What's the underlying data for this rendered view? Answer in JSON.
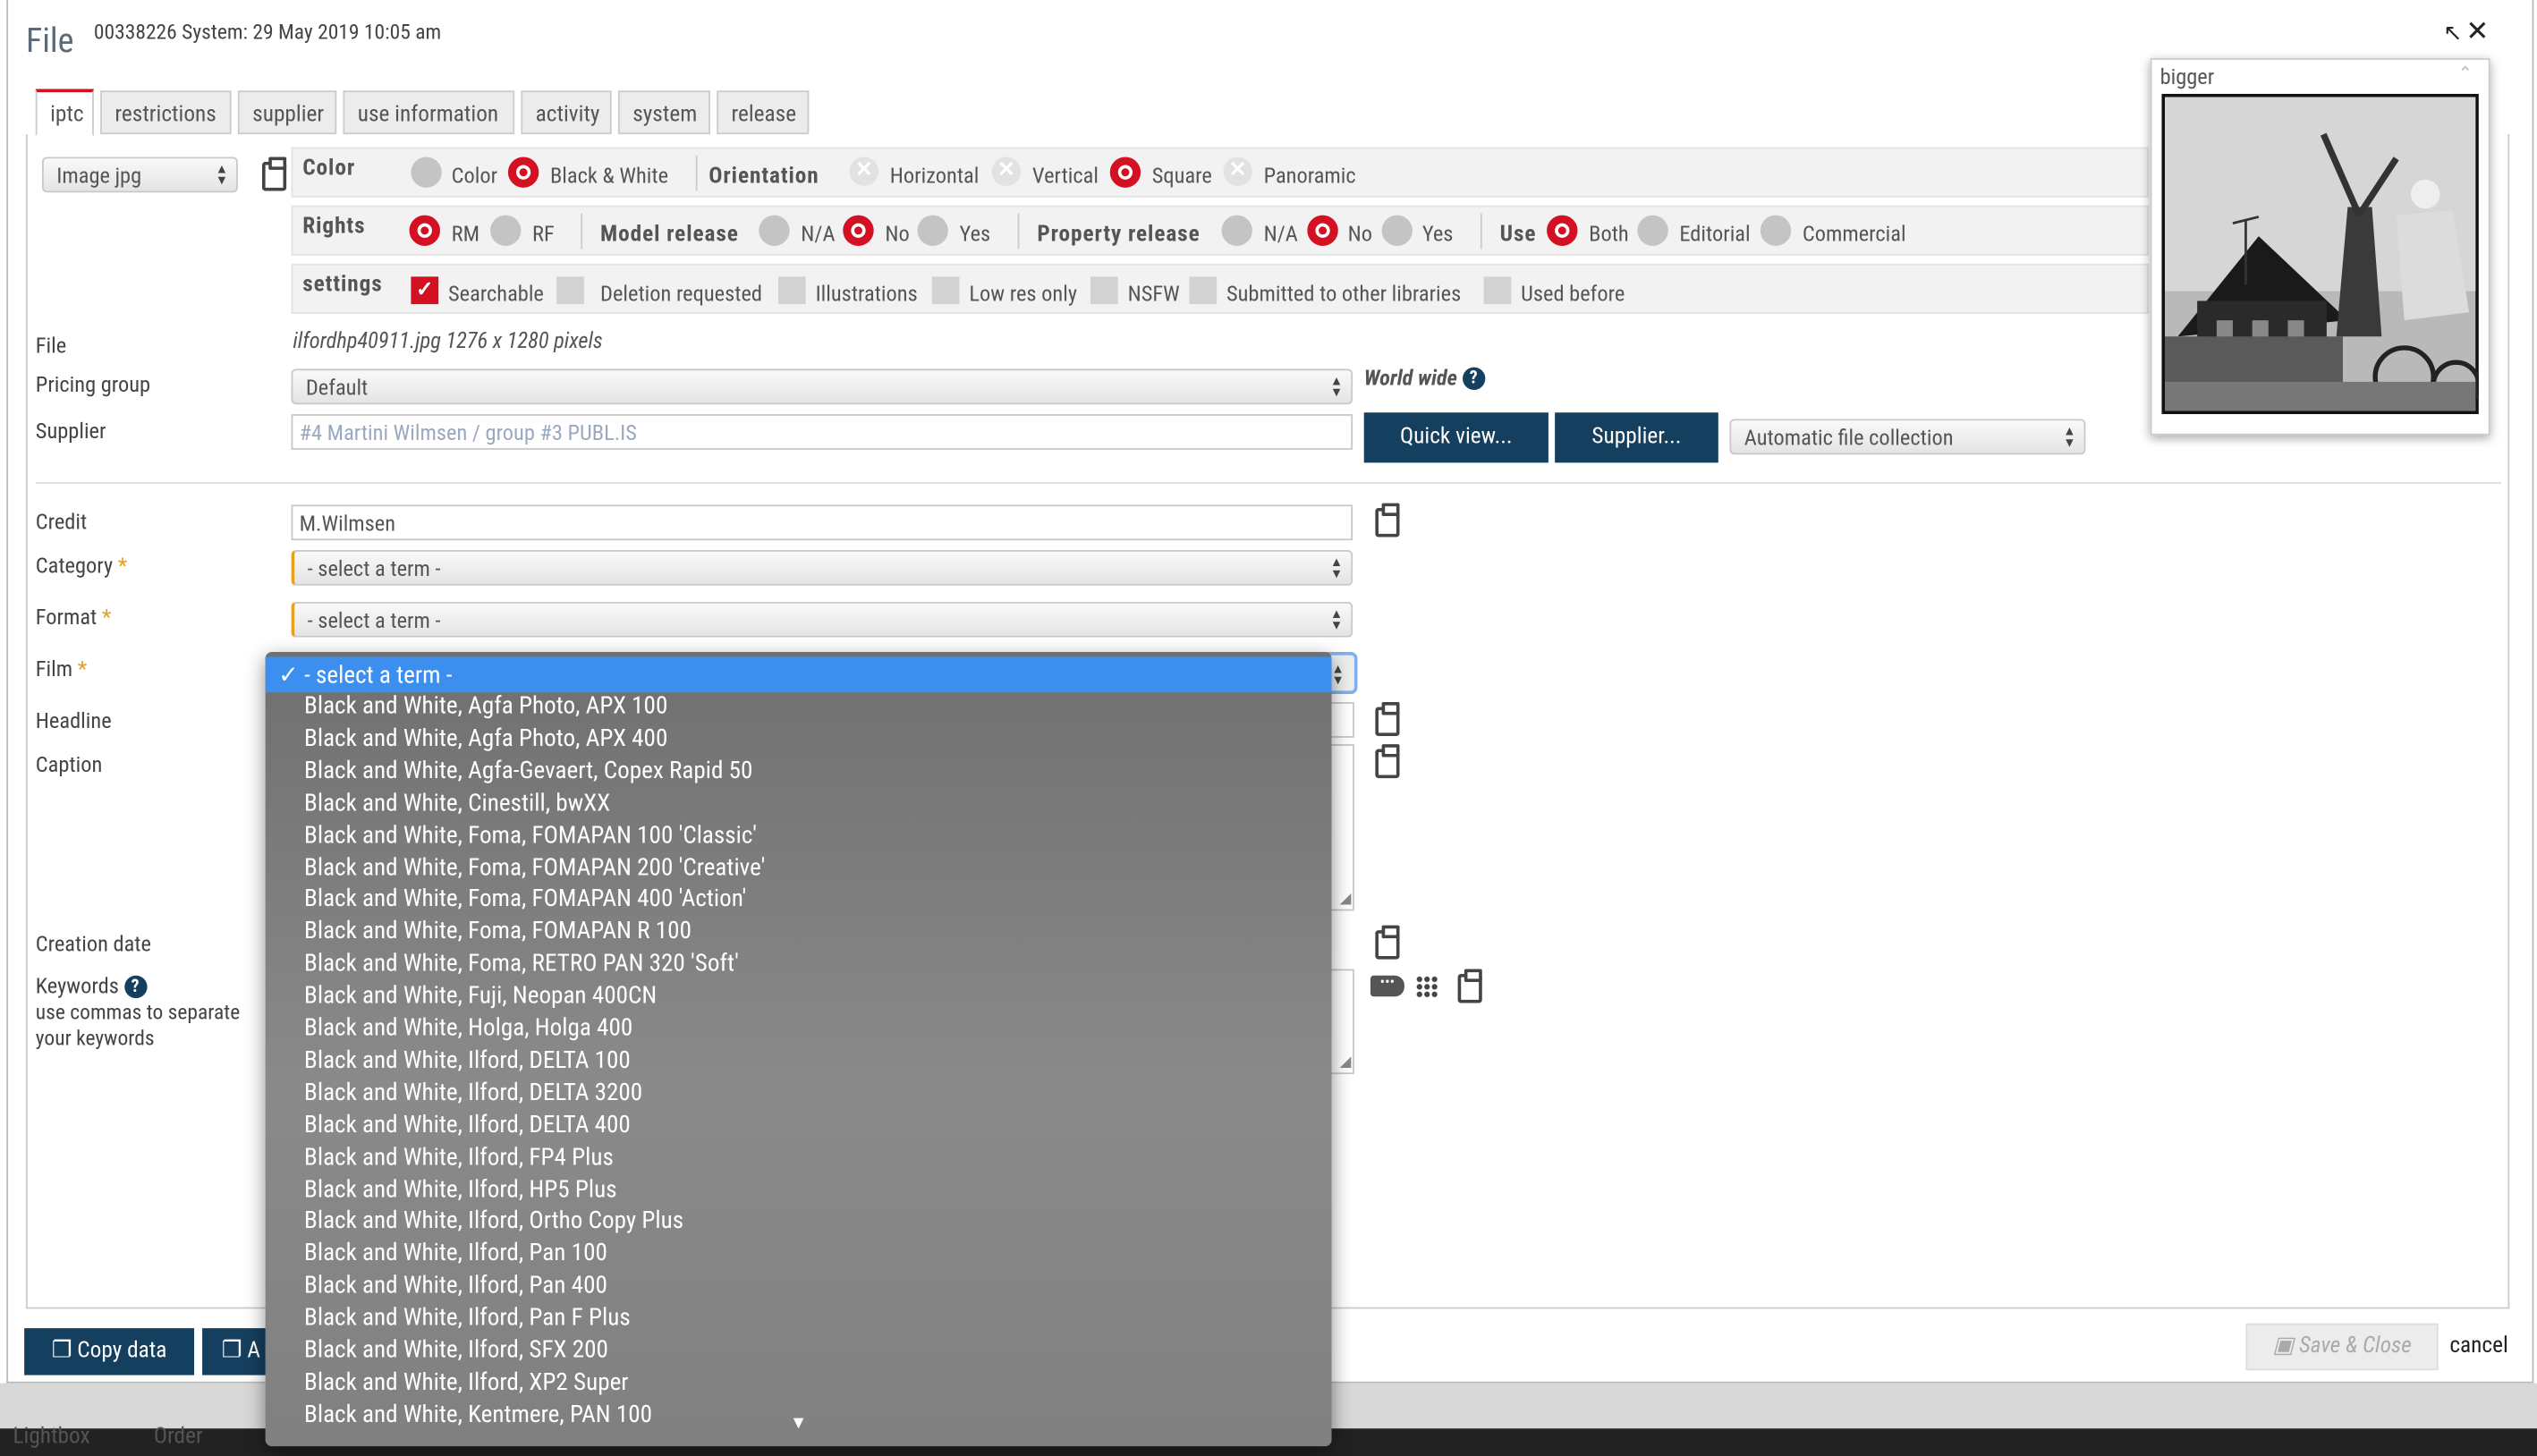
{
  "header": {
    "title": "File",
    "system_line": "00338226 System: 29 May 2019 10:05 am"
  },
  "tabs": [
    "iptc",
    "restrictions",
    "supplier",
    "use information",
    "activity",
    "system",
    "release"
  ],
  "type_select": "Image jpg",
  "color_band": {
    "title": "Color",
    "options": [
      "Color",
      "Black & White"
    ],
    "selected": "Black & White",
    "orientation_title": "Orientation",
    "orientation_options": [
      "Horizontal",
      "Vertical",
      "Square",
      "Panoramic"
    ],
    "orientation_selected": "Square"
  },
  "rights_band": {
    "title": "Rights",
    "rights_options": [
      "RM",
      "RF"
    ],
    "rights_selected": "RM",
    "model_title": "Model release",
    "model_options": [
      "N/A",
      "No",
      "Yes"
    ],
    "model_selected": "No",
    "property_title": "Property release",
    "property_options": [
      "N/A",
      "No",
      "Yes"
    ],
    "property_selected": "No",
    "use_title": "Use",
    "use_options": [
      "Both",
      "Editorial",
      "Commercial"
    ],
    "use_selected": "Both"
  },
  "settings_band": {
    "title": "settings",
    "checkboxes": [
      {
        "label": "Searchable",
        "checked": true
      },
      {
        "label": "Deletion requested",
        "checked": false
      },
      {
        "label": "Illustrations",
        "checked": false
      },
      {
        "label": "Low res only",
        "checked": false
      },
      {
        "label": "NSFW",
        "checked": false
      },
      {
        "label": "Submitted to other libraries",
        "checked": false
      },
      {
        "label": "Used before",
        "checked": false
      }
    ]
  },
  "fields": {
    "file_label": "File",
    "file_value": "ilfordhp40911.jpg 1276 x 1280 pixels",
    "pricing_label": "Pricing group",
    "pricing_value": "Default",
    "world_wide": "World wide",
    "supplier_label": "Supplier",
    "supplier_placeholder": "#4 Martini Wilmsen / group #3 PUBL.IS",
    "quick_view": "Quick view...",
    "supplier_button": "Supplier...",
    "collection_value": "Automatic file collection",
    "credit_label": "Credit",
    "credit_value": "M.Wilmsen",
    "category_label": "Category",
    "category_value": "- select a term -",
    "format_label": "Format",
    "format_value": "- select a term -",
    "film_label": "Film",
    "required_mark": "*",
    "headline_label": "Headline",
    "caption_label": "Caption",
    "creation_label": "Creation date",
    "keywords_label": "Keywords",
    "keywords_hint_1": "use commas to separate",
    "keywords_hint_2": "your keywords"
  },
  "thumbnail": {
    "label": "bigger"
  },
  "footer": {
    "copy_data": "Copy data",
    "second_button": "A",
    "save_close": "Save & Close",
    "cancel": "cancel",
    "bottom_left_1": "Lightbox",
    "bottom_left_2": "Order"
  },
  "film_dropdown": {
    "selected": "- select a term -",
    "items": [
      "Black and White, Agfa Photo, APX 100",
      "Black and White, Agfa Photo, APX 400",
      "Black and White, Agfa-Gevaert, Copex Rapid 50",
      "Black and White, Cinestill, bwXX",
      "Black and White, Foma, FOMAPAN 100 'Classic'",
      "Black and White, Foma, FOMAPAN 200 'Creative'",
      "Black and White, Foma, FOMAPAN 400 'Action'",
      "Black and White, Foma, FOMAPAN R 100",
      "Black and White, Foma, RETRO PAN 320 'Soft'",
      "Black and White, Fuji, Neopan 400CN",
      "Black and White, Holga, Holga 400",
      "Black and White, Ilford, DELTA 100",
      "Black and White, Ilford, DELTA 3200",
      "Black and White, Ilford, DELTA 400",
      "Black and White, Ilford, FP4 Plus",
      "Black and White, Ilford, HP5 Plus",
      "Black and White, Ilford, Ortho Copy Plus",
      "Black and White, Ilford, Pan 100",
      "Black and White, Ilford, Pan 400",
      "Black and White, Ilford, Pan F Plus",
      "Black and White, Ilford, SFX 200",
      "Black and White, Ilford, XP2 Super",
      "Black and White, Kentmere, PAN 100"
    ]
  },
  "colors": {
    "accent_red": "#d31122",
    "button_navy": "#153f5e",
    "dropdown_highlight": "#3d8fef"
  }
}
